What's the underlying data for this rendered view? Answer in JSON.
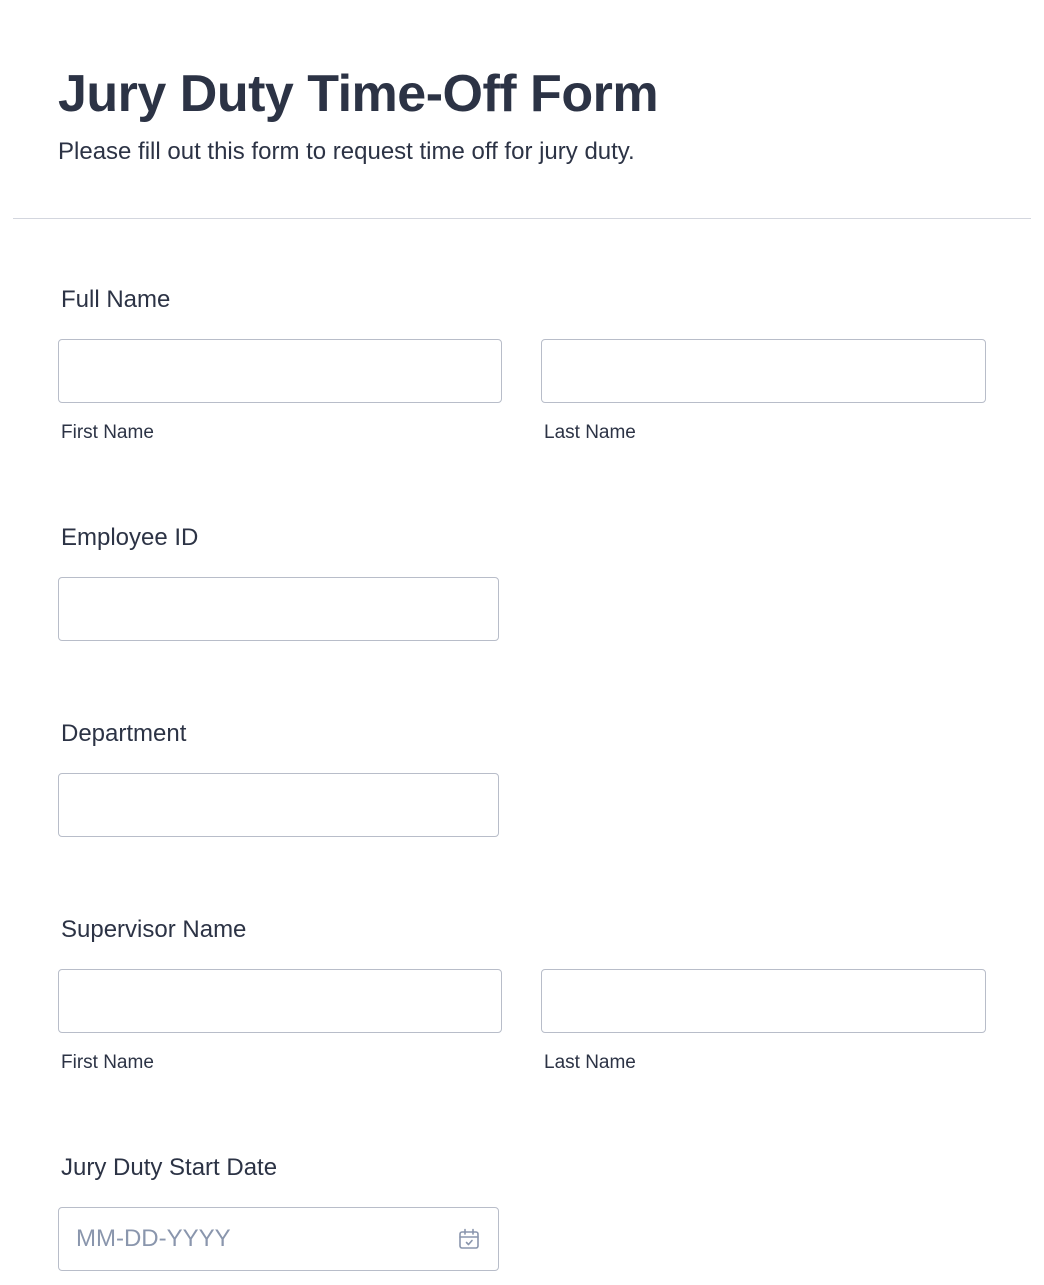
{
  "form": {
    "title": "Jury Duty Time-Off Form",
    "subtitle": "Please fill out this form to request time off for jury duty."
  },
  "fields": {
    "full_name": {
      "label": "Full Name",
      "first_value": "",
      "last_value": "",
      "first_sublabel": "First Name",
      "last_sublabel": "Last Name"
    },
    "employee_id": {
      "label": "Employee ID",
      "value": ""
    },
    "department": {
      "label": "Department",
      "value": ""
    },
    "supervisor_name": {
      "label": "Supervisor Name",
      "first_value": "",
      "last_value": "",
      "first_sublabel": "First Name",
      "last_sublabel": "Last Name"
    },
    "start_date": {
      "label": "Jury Duty Start Date",
      "placeholder": "MM-DD-YYYY",
      "value": "",
      "icon": "calendar-icon"
    }
  },
  "colors": {
    "text": "#2c3345",
    "input_border": "#b8bdc9",
    "placeholder": "#8a96ad",
    "divider": "#d3d6de"
  }
}
